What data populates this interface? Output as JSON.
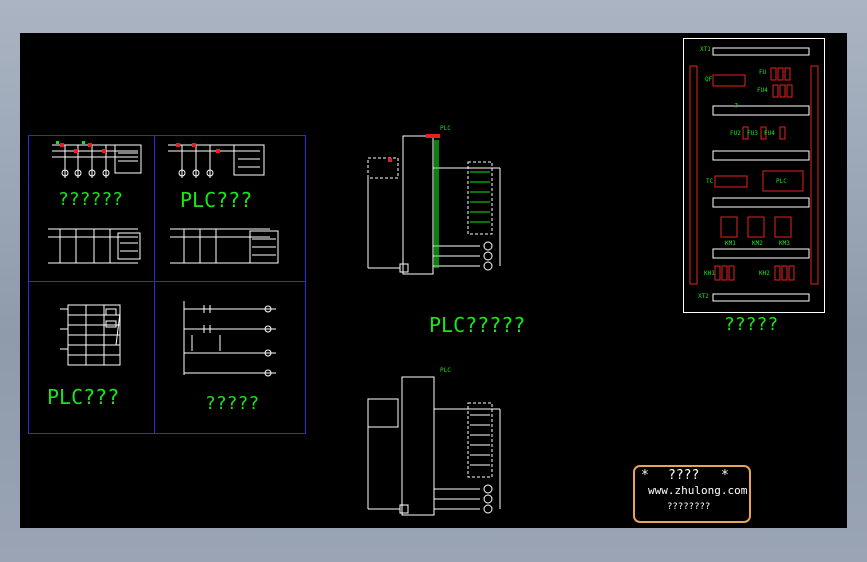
{
  "colors": {
    "background": "#000000",
    "wire": "#ffffff",
    "accent_red": "#e62020",
    "label_green": "#19e619",
    "frame_blue": "#2a2ae6",
    "legend_border": "#e6a35a"
  },
  "thumbnails": {
    "top_left_caption": "??????",
    "top_right_caption": "PLC???",
    "bottom_left_caption": "PLC???",
    "bottom_right_caption": "?????"
  },
  "center": {
    "plc_caption": "PLC?????",
    "top_unit_label": "PLC",
    "bottom_unit_label": "PLC"
  },
  "panel": {
    "caption": "?????",
    "rail_top": "XT1",
    "rail_bottom": "XT2",
    "box_qf": "QF",
    "box_fu": "FU",
    "box_fu4": "FU4",
    "box_fu2": "FU2",
    "box_fu3": "FU3",
    "box_fu4b": "FU4",
    "box_tc": "TC",
    "box_plc": "PLC",
    "km1": "KM1",
    "km2": "KM2",
    "km3": "KM3",
    "kh1": "KH1",
    "kh2": "KH2",
    "trunk_mark": "?"
  },
  "legend": {
    "title": "????",
    "star_left": "*",
    "star_right": "*",
    "url": "www.zhulong.com",
    "subtitle": "????????"
  }
}
